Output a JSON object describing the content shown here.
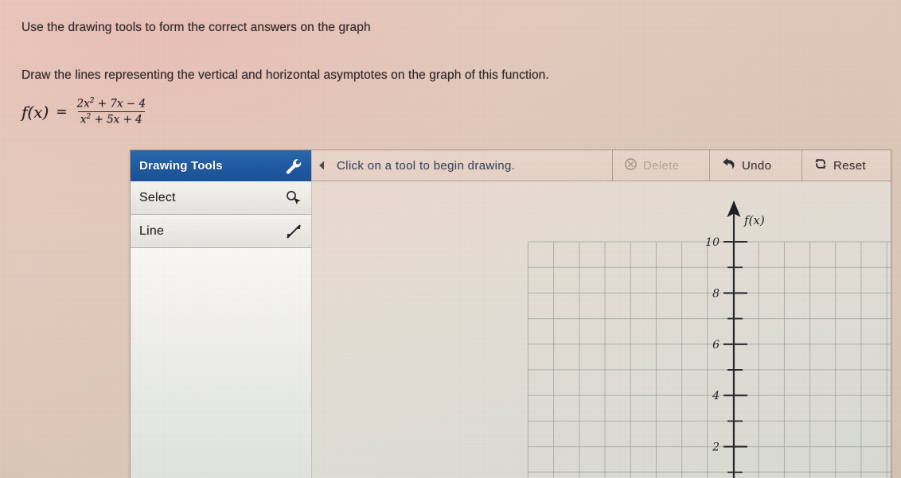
{
  "prompts": {
    "line1": "Use the drawing tools to form the correct answers on the graph",
    "line2": "Draw the lines representing the vertical and horizontal asymptotes on the graph of this function."
  },
  "formula": {
    "lhs": "f(x)",
    "equals": "=",
    "numerator_a": "2x",
    "numerator_exp": "2",
    "numerator_b": " + 7x − 4",
    "denominator_a": "x",
    "denominator_exp": "2",
    "denominator_b": " + 5x + 4"
  },
  "widget": {
    "tools_header": {
      "title": "Drawing Tools",
      "icon": "wrench-icon"
    },
    "tools": [
      {
        "label": "Select",
        "icon": "select-cursor-icon"
      },
      {
        "label": "Line",
        "icon": "line-double-arrow-icon"
      }
    ],
    "statusbar": {
      "collapse_icon": "collapse-left-arrow-icon",
      "hint": "Click on a tool to begin drawing.",
      "buttons": [
        {
          "label": "Delete",
          "icon": "delete-circle-x-icon",
          "disabled": true
        },
        {
          "label": "Undo",
          "icon": "undo-arrow-icon",
          "disabled": false
        },
        {
          "label": "Reset",
          "icon": "reset-refresh-icon",
          "disabled": false
        }
      ]
    }
  },
  "chart_data": {
    "type": "line",
    "title": "",
    "xlabel": "",
    "ylabel": "f(x)",
    "axis_label": "f(x)",
    "y_ticks": [
      10,
      8,
      6,
      4,
      2
    ],
    "y_minor_ticks": [
      9,
      7,
      5,
      3,
      1
    ],
    "x_ticks": [],
    "grid": true,
    "grid_spacing_units": 1,
    "ylim": [
      0.6,
      10.6
    ],
    "xlim": [
      -10,
      11
    ],
    "series": [],
    "notes": "Empty coordinate grid; student must draw asymptote lines."
  },
  "colors": {
    "header_blue": "#1f5ba2",
    "hint_text": "#3b4a63",
    "paper": "#e2ccbe",
    "grid_line": "#9aa6a2"
  }
}
